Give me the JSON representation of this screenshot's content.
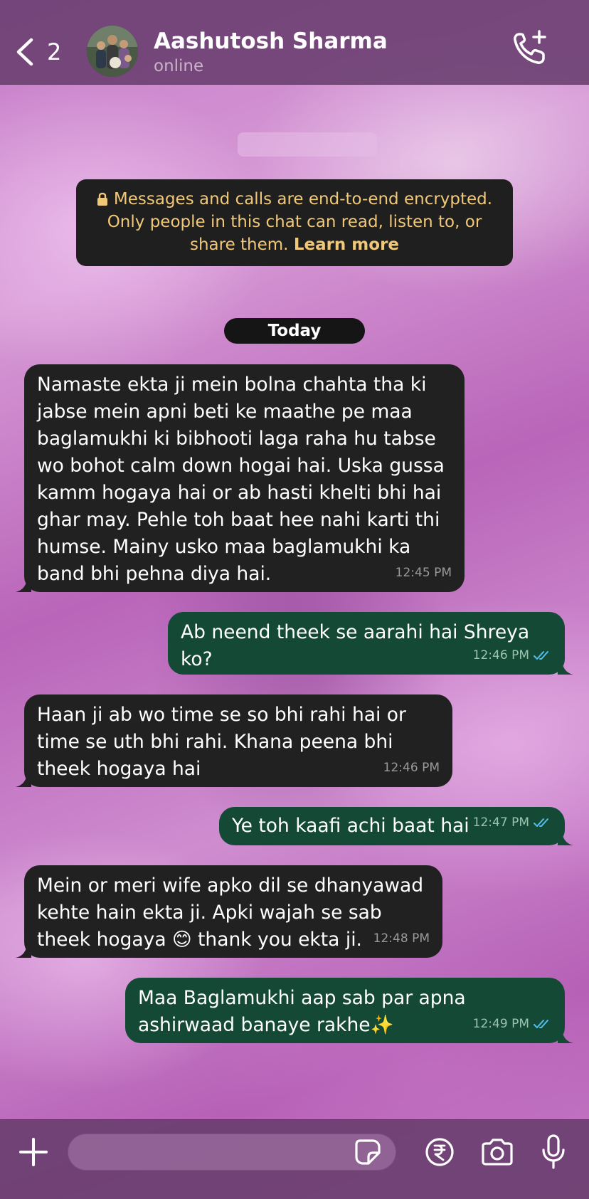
{
  "header": {
    "back_count": "2",
    "contact_name": "Aashutosh Sharma",
    "status": "online"
  },
  "encryption_notice": {
    "text": "Messages and calls are end-to-end encrypted. Only people in this chat can read, listen to, or share them.",
    "learn_more": "Learn more"
  },
  "date_divider": "Today",
  "messages": [
    {
      "direction": "incoming",
      "text": "Namaste ekta ji mein bolna chahta tha ki jabse mein apni beti ke maathe pe maa baglamukhi ki bibhooti laga raha hu tabse wo bohot calm down hogai hai. Uska gussa kamm hogaya hai or ab hasti khelti bhi hai ghar may. Pehle toh baat hee nahi karti thi humse. Mainy usko maa baglamukhi ka band bhi pehna diya hai.",
      "time": "12:45 PM"
    },
    {
      "direction": "outgoing",
      "text": "Ab neend theek se aarahi hai Shreya ko?",
      "time": "12:46 PM",
      "status": "read"
    },
    {
      "direction": "incoming",
      "text": "Haan ji ab wo time se so bhi rahi hai or time se uth bhi rahi. Khana peena bhi theek hogaya hai",
      "time": "12:46 PM"
    },
    {
      "direction": "outgoing",
      "text": "Ye toh kaafi achi baat hai",
      "time": "12:47 PM",
      "status": "read"
    },
    {
      "direction": "incoming",
      "text": "Mein or meri wife apko dil se dhanyawad kehte hain ekta ji. Apki wajah se sab theek hogaya 😊 thank you ekta ji.",
      "time": "12:48 PM"
    },
    {
      "direction": "outgoing",
      "text": "Maa Baglamukhi aap sab par apna ashirwaad banaye rakhe✨",
      "time": "12:49 PM",
      "status": "read"
    }
  ],
  "input": {
    "value": "",
    "placeholder": ""
  },
  "icons": {
    "back": "chevron-left-icon",
    "call": "add-call-icon",
    "lock": "lock-icon",
    "attach": "plus-icon",
    "sticker": "sticker-icon",
    "payment": "rupee-icon",
    "camera": "camera-icon",
    "mic": "microphone-icon",
    "read_receipt": "double-check-icon"
  },
  "colors": {
    "header_bg": "#693e6e",
    "incoming_bubble": "#212121",
    "outgoing_bubble": "#144a35",
    "notice_text": "#f0c878",
    "read_tick": "#53bdeb"
  }
}
